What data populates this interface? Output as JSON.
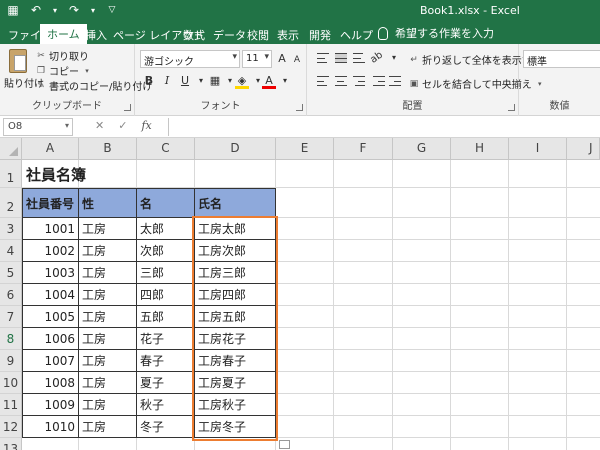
{
  "titlebar": {
    "filename": "Book1.xlsx",
    "separator": " - ",
    "app": "Excel"
  },
  "tabs": [
    "ファイル",
    "ホーム",
    "挿入",
    "ページ レイアウト",
    "数式",
    "データ",
    "校閲",
    "表示",
    "開発",
    "ヘルプ"
  ],
  "active_tab": "ホーム",
  "tell_me": "希望する作業を入力",
  "ribbon": {
    "clipboard": {
      "paste": "貼り付け",
      "cut": "切り取り",
      "copy": "コピー",
      "format_painter": "書式のコピー/貼り付け",
      "label": "クリップボード"
    },
    "font": {
      "font_name": "游ゴシック",
      "font_size": "11",
      "grow": "A",
      "shrink": "A",
      "bold": "B",
      "italic": "I",
      "underline": "U",
      "font_color": "A",
      "label": "フォント"
    },
    "alignment": {
      "wrap": "折り返して全体を表示する",
      "merge": "セルを結合して中央揃え",
      "label": "配置"
    },
    "number": {
      "format": "標準",
      "label": "数値"
    }
  },
  "formula_bar": {
    "name_box": "O8",
    "cancel": "✕",
    "confirm": "✓",
    "fx": "fx",
    "value": ""
  },
  "columns": [
    "A",
    "B",
    "C",
    "D",
    "E",
    "F",
    "G",
    "H",
    "I",
    "J"
  ],
  "rows": [
    "1",
    "2",
    "3",
    "4",
    "5",
    "6",
    "7",
    "8",
    "9",
    "10",
    "11",
    "12",
    "13"
  ],
  "selected_row": "8",
  "sheet": {
    "title": "社員名簿",
    "headers": [
      "社員番号",
      "性",
      "名",
      "氏名"
    ],
    "records": [
      {
        "id": "1001",
        "sei": "工房",
        "mei": "太郎",
        "shimei": "工房太郎"
      },
      {
        "id": "1002",
        "sei": "工房",
        "mei": "次郎",
        "shimei": "工房次郎"
      },
      {
        "id": "1003",
        "sei": "工房",
        "mei": "三郎",
        "shimei": "工房三郎"
      },
      {
        "id": "1004",
        "sei": "工房",
        "mei": "四郎",
        "shimei": "工房四郎"
      },
      {
        "id": "1005",
        "sei": "工房",
        "mei": "五郎",
        "shimei": "工房五郎"
      },
      {
        "id": "1006",
        "sei": "工房",
        "mei": "花子",
        "shimei": "工房花子"
      },
      {
        "id": "1007",
        "sei": "工房",
        "mei": "春子",
        "shimei": "工房春子"
      },
      {
        "id": "1008",
        "sei": "工房",
        "mei": "夏子",
        "shimei": "工房夏子"
      },
      {
        "id": "1009",
        "sei": "工房",
        "mei": "秋子",
        "shimei": "工房秋子"
      },
      {
        "id": "1010",
        "sei": "工房",
        "mei": "冬子",
        "shimei": "工房冬子"
      }
    ]
  },
  "colors": {
    "brand": "#217346",
    "header_fill": "#8ea9db",
    "highlight": "#ed7d31"
  }
}
